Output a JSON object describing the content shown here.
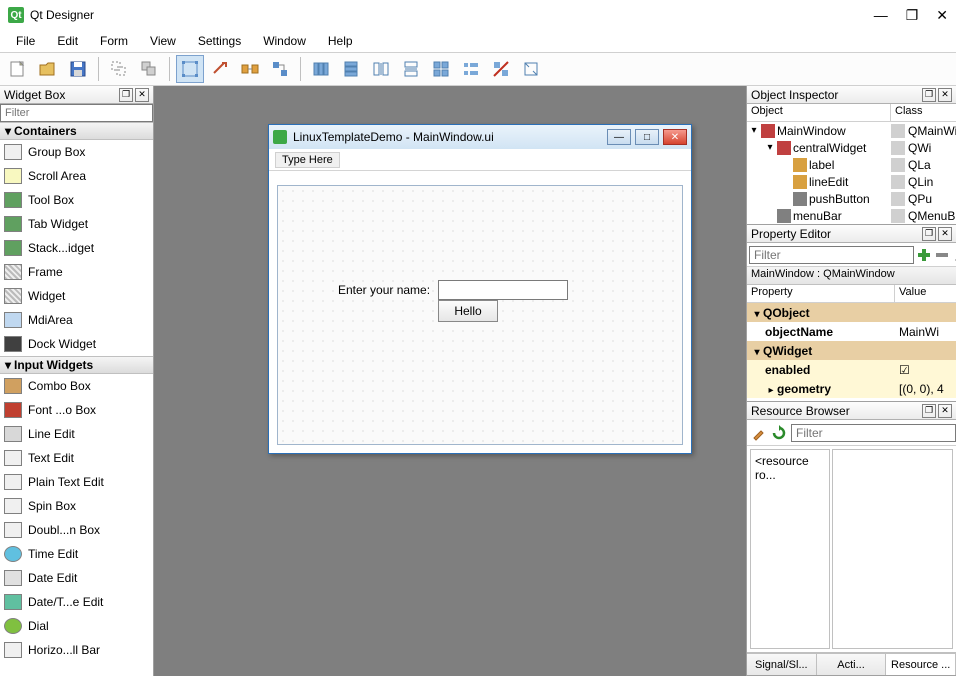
{
  "app": {
    "title": "Qt Designer"
  },
  "menubar": [
    "File",
    "Edit",
    "Form",
    "View",
    "Settings",
    "Window",
    "Help"
  ],
  "widgetbox": {
    "title": "Widget Box",
    "filter_placeholder": "Filter",
    "categories": [
      {
        "name": "Containers",
        "items": [
          "Group Box",
          "Scroll Area",
          "Tool Box",
          "Tab Widget",
          "Stack...idget",
          "Frame",
          "Widget",
          "MdiArea",
          "Dock Widget"
        ]
      },
      {
        "name": "Input Widgets",
        "items": [
          "Combo Box",
          "Font ...o Box",
          "Line Edit",
          "Text Edit",
          "Plain Text Edit",
          "Spin Box",
          "Doubl...n Box",
          "Time Edit",
          "Date Edit",
          "Date/T...e Edit",
          "Dial",
          "Horizo...ll Bar"
        ]
      }
    ]
  },
  "form": {
    "title": "LinuxTemplateDemo - MainWindow.ui",
    "type_here": "Type Here",
    "label": "Enter your name:",
    "button": "Hello"
  },
  "object_inspector": {
    "title": "Object Inspector",
    "cols": {
      "object": "Object",
      "class": "Class"
    },
    "tree": [
      {
        "indent": 0,
        "exp": "▾",
        "name": "MainWindow",
        "class": "QMainWin"
      },
      {
        "indent": 1,
        "exp": "▾",
        "name": "centralWidget",
        "class": "QWi"
      },
      {
        "indent": 2,
        "exp": "",
        "name": "label",
        "class": "QLa"
      },
      {
        "indent": 2,
        "exp": "",
        "name": "lineEdit",
        "class": "QLin"
      },
      {
        "indent": 2,
        "exp": "",
        "name": "pushButton",
        "class": "QPu"
      },
      {
        "indent": 1,
        "exp": "",
        "name": "menuBar",
        "class": "QMenuB"
      }
    ]
  },
  "property_editor": {
    "title": "Property Editor",
    "filter_placeholder": "Filter",
    "context": "MainWindow : QMainWindow",
    "cols": {
      "property": "Property",
      "value": "Value"
    },
    "rows": [
      {
        "type": "section",
        "exp": "▾",
        "name": "QObject",
        "value": ""
      },
      {
        "type": "prop",
        "name": "objectName",
        "value": "MainWi"
      },
      {
        "type": "section",
        "exp": "▾",
        "name": "QWidget",
        "value": ""
      },
      {
        "type": "yellow",
        "name": "enabled",
        "value": "☑"
      },
      {
        "type": "yellow",
        "exp": "▸",
        "name": "geometry",
        "value": "[(0, 0), 4"
      }
    ]
  },
  "resource_browser": {
    "title": "Resource Browser",
    "filter_placeholder": "Filter",
    "root": "<resource ro...",
    "tabs": [
      "Signal/Sl...",
      "Acti...",
      "Resource ..."
    ]
  }
}
